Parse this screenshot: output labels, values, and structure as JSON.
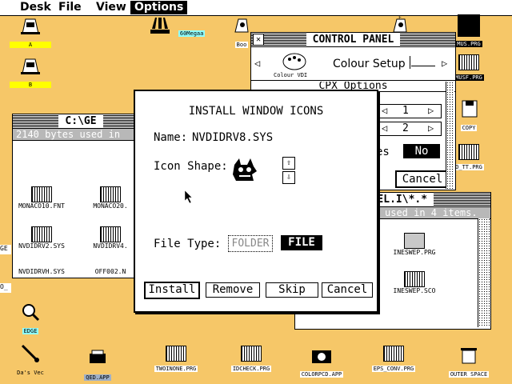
{
  "menubar": {
    "items": [
      "Desk",
      "File",
      "View",
      "Options"
    ],
    "active": "Options"
  },
  "desktop_icons": [
    {
      "label": "A",
      "icon": "floppy-drive-icon"
    },
    {
      "label": "B",
      "icon": "floppy-drive-icon"
    },
    {
      "label": "60Megaa",
      "icon": "atari-logo-icon"
    },
    {
      "label": "Boo",
      "icon": "hard-drive-icon"
    },
    {
      "label": "E",
      "icon": "hard-drive-icon"
    },
    {
      "label": "MUS.PRG",
      "icon": "program-icon"
    },
    {
      "label": "MUSF.PRG",
      "icon": "program-icon"
    },
    {
      "label": "COPY",
      "icon": "disk-copy-icon"
    },
    {
      "label": "O_TT.PRG",
      "icon": "program-icon"
    },
    {
      "label": "EDGE",
      "icon": "magnifier-icon"
    },
    {
      "label": "Da's Vec",
      "icon": "brush-icon"
    },
    {
      "label": "QED.APP",
      "icon": "typewriter-icon"
    },
    {
      "label": "TWOINONE.PRG",
      "icon": "program-icon"
    },
    {
      "label": "IDCHECK.PRG",
      "icon": "program-icon"
    },
    {
      "label": "COLORPCD.APP",
      "icon": "camera-icon"
    },
    {
      "label": "EPS_CONV.PRG",
      "icon": "program-icon"
    },
    {
      "label": "OUTER SPACE",
      "icon": "trash-can-icon"
    }
  ],
  "left_edge_labels": [
    "GE",
    "O_"
  ],
  "window_c": {
    "title": "C:\\GE",
    "info": "2140 bytes used in",
    "files": [
      "MONACO10.FNT",
      "MONACO20.",
      "NVDIDRV2.SYS",
      "NVDIDRV4.",
      "NVDIDRVH.SYS",
      "OFF002.N"
    ]
  },
  "window_chapel": {
    "title": "HAPEL.I\\*.*",
    "info": "used in 4 items.",
    "files": [
      "INESWEP.PRG",
      "INESWEP.SCO"
    ]
  },
  "control_panel": {
    "title": "CONTROL PANEL",
    "cpx_label": "Colour Setup",
    "cpx_sub": "Colour VDI",
    "options_title": "CPX Options",
    "value1": "1",
    "value2": "2",
    "yes_label": "es",
    "no_label": "No",
    "cancel_label": "Cancel"
  },
  "dialog": {
    "title": "INSTALL WINDOW ICONS",
    "name_label": "Name:",
    "name_value": "NVDIDRV8.SYS",
    "shape_label": "Icon Shape:",
    "filetype_label": "File Type:",
    "folder_label": "FOLDER",
    "file_label": "FILE",
    "buttons": [
      "Install",
      "Remove",
      "Skip",
      "Cancel"
    ]
  }
}
